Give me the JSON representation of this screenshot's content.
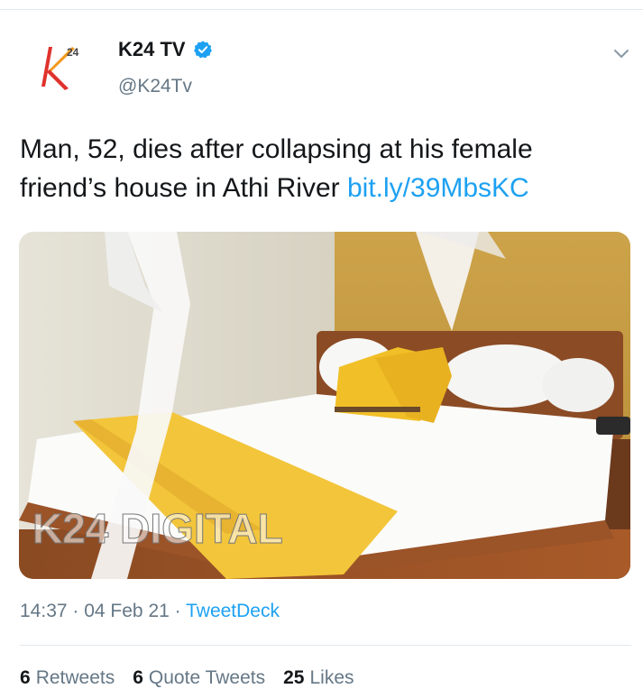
{
  "tweet": {
    "display_name": "K24 TV",
    "handle": "@K24Tv",
    "avatar_text": "24",
    "text": "Man, 52, dies after collapsing at his female friend’s house in Athi River ",
    "link": "bit.ly/39MbsKC",
    "watermark": "K24 DIGITAL",
    "time": "14:37",
    "date": "04 Feb 21",
    "separator": " · ",
    "source": "TweetDeck"
  },
  "stats": {
    "retweets_count": "6",
    "retweets_label": "Retweets",
    "quotes_count": "6",
    "quotes_label": "Quote Tweets",
    "likes_count": "25",
    "likes_label": "Likes"
  },
  "colors": {
    "link": "#1da1f2",
    "secondary": "#657786",
    "verified": "#1da1f2",
    "logo_red": "#e0312b",
    "logo_orange": "#f39a1e"
  },
  "icons": {
    "verified": "verified-badge-icon",
    "caret": "chevron-down-icon"
  }
}
